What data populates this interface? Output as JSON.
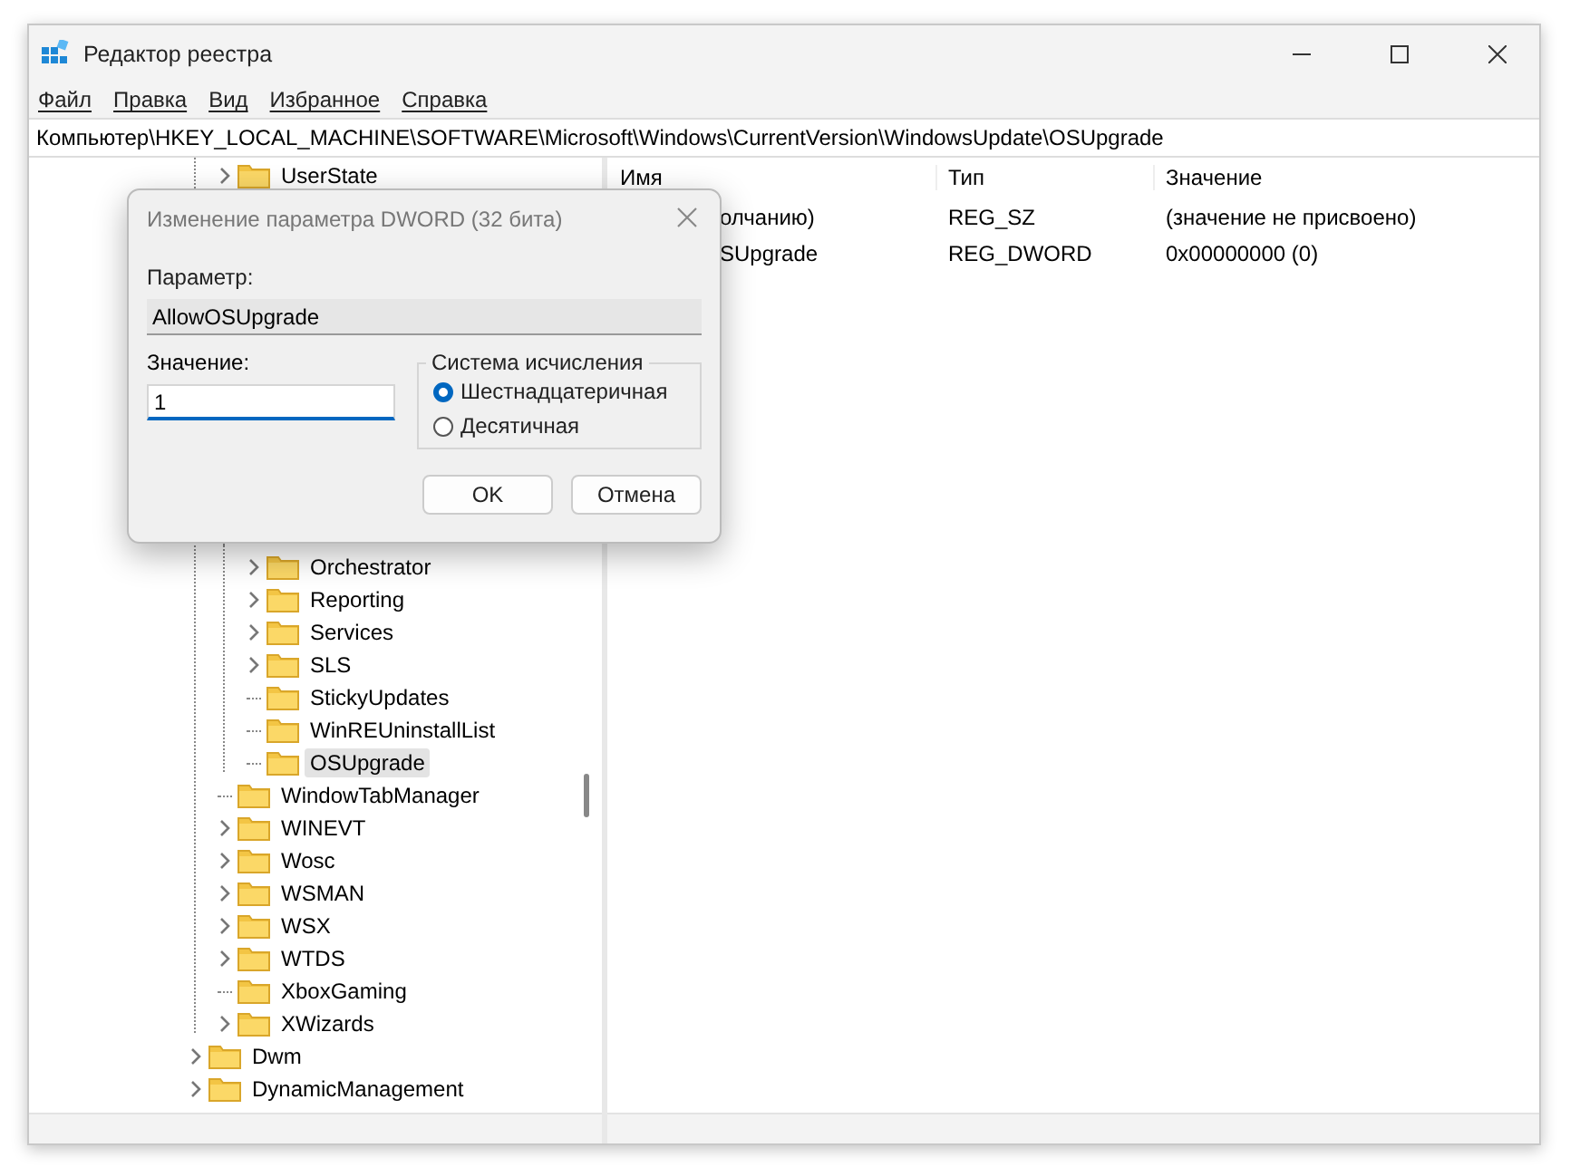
{
  "window": {
    "title": "Редактор реестра"
  },
  "menu": [
    "Файл",
    "Правка",
    "Вид",
    "Избранное",
    "Справка"
  ],
  "address": "Компьютер\\HKEY_LOCAL_MACHINE\\SOFTWARE\\Microsoft\\Windows\\CurrentVersion\\WindowsUpdate\\OSUpgrade",
  "tree": [
    {
      "kind": "offscreen",
      "children": [
        {
          "kind": "row",
          "label": "UserState",
          "expandable": true,
          "selected": false
        },
        {
          "kind": "covered",
          "children": [
            {
              "kind": "row",
              "label": "Orchestrator",
              "expandable": true,
              "selected": false
            },
            {
              "kind": "row",
              "label": "Reporting",
              "expandable": true,
              "selected": false
            },
            {
              "kind": "row",
              "label": "Services",
              "expandable": true,
              "selected": false
            },
            {
              "kind": "row",
              "label": "SLS",
              "expandable": true,
              "selected": false
            },
            {
              "kind": "row",
              "label": "StickyUpdates",
              "expandable": false,
              "selected": false
            },
            {
              "kind": "row",
              "label": "WinREUninstallList",
              "expandable": false,
              "selected": false
            },
            {
              "kind": "row",
              "label": "OSUpgrade",
              "expandable": false,
              "selected": true
            }
          ]
        },
        {
          "kind": "row",
          "label": "WindowTabManager",
          "expandable": false,
          "selected": false
        },
        {
          "kind": "row",
          "label": "WINEVT",
          "expandable": true,
          "selected": false
        },
        {
          "kind": "row",
          "label": "Wosc",
          "expandable": true,
          "selected": false
        },
        {
          "kind": "row",
          "label": "WSMAN",
          "expandable": true,
          "selected": false
        },
        {
          "kind": "row",
          "label": "WSX",
          "expandable": true,
          "selected": false
        },
        {
          "kind": "row",
          "label": "WTDS",
          "expandable": true,
          "selected": false
        },
        {
          "kind": "row",
          "label": "XboxGaming",
          "expandable": false,
          "selected": false
        },
        {
          "kind": "row",
          "label": "XWizards",
          "expandable": true,
          "selected": false
        }
      ]
    },
    {
      "kind": "row",
      "label": "Dwm",
      "expandable": true,
      "selected": false
    },
    {
      "kind": "row",
      "label": "DynamicManagement",
      "expandable": true,
      "selected": false
    }
  ],
  "values": {
    "columns": [
      "Имя",
      "Тип",
      "Значение"
    ],
    "rows": [
      {
        "name": "олчанию)",
        "type": "REG_SZ",
        "value": "(значение не присвоено)"
      },
      {
        "name": "SUpgrade",
        "type": "REG_DWORD",
        "value": "0x00000000 (0)"
      }
    ]
  },
  "dialog": {
    "title": "Изменение параметра DWORD (32 бита)",
    "name_label": "Параметр:",
    "name_value": "AllowOSUpgrade",
    "value_label": "Значение:",
    "value": "1",
    "base_group": "Система исчисления",
    "bases": [
      {
        "label": "Шестнадцатеричная",
        "selected": true
      },
      {
        "label": "Десятичная",
        "selected": false
      }
    ],
    "buttons": [
      "OK",
      "Отмена"
    ]
  }
}
